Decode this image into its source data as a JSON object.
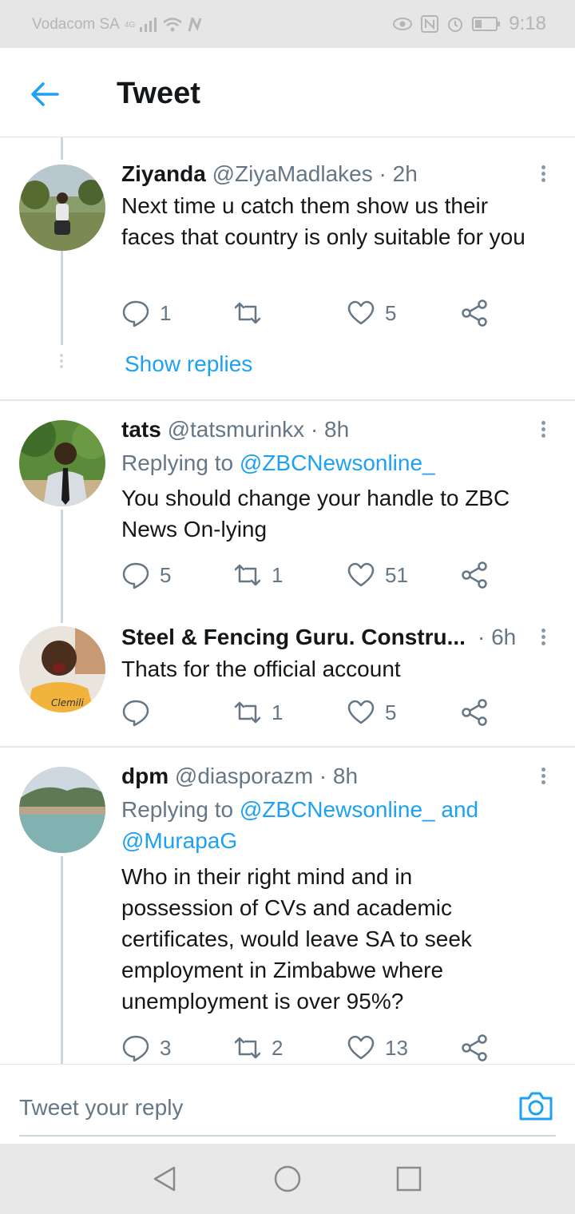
{
  "status_bar": {
    "carrier": "Vodacom SA",
    "network": "4G",
    "time": "9:18"
  },
  "header": {
    "title": "Tweet"
  },
  "tweets": [
    {
      "name": "Ziyanda",
      "handle": "@ZiyaMadlakes",
      "time": "· 2h",
      "body": "Next time u catch them show us their faces that country is only suitable for you",
      "replies": "1",
      "retweets": "",
      "likes": "5",
      "show_replies": "Show replies"
    },
    {
      "name": "tats",
      "handle": "@tatsmurinkx",
      "time": "· 8h",
      "replying_prefix": "Replying to",
      "replying_to": "@ZBCNewsonline_",
      "body": "You should change your handle to ZBC News On-lying",
      "replies": "5",
      "retweets": "1",
      "likes": "51"
    },
    {
      "name": "Steel & Fencing Guru. Constru...",
      "handle": "",
      "time": "· 6h",
      "body": "Thats for the official account",
      "replies": "",
      "retweets": "1",
      "likes": "5"
    },
    {
      "name": "dpm",
      "handle": "@diasporazm",
      "time": "· 8h",
      "replying_prefix": "Replying to",
      "replying_to": "@ZBCNewsonline_ and @MurapaG",
      "body": "Who in their right mind and in possession of CVs and academic certificates, would leave SA to seek employment in Zimbabwe where unemployment is over 95%?",
      "replies": "3",
      "retweets": "2",
      "likes": "13"
    }
  ],
  "composer": {
    "placeholder": "Tweet your reply"
  },
  "colors": {
    "accent": "#1da1f2",
    "secondary_text": "#657786",
    "primary_text": "#14171a",
    "divider": "#e1e8ed"
  }
}
